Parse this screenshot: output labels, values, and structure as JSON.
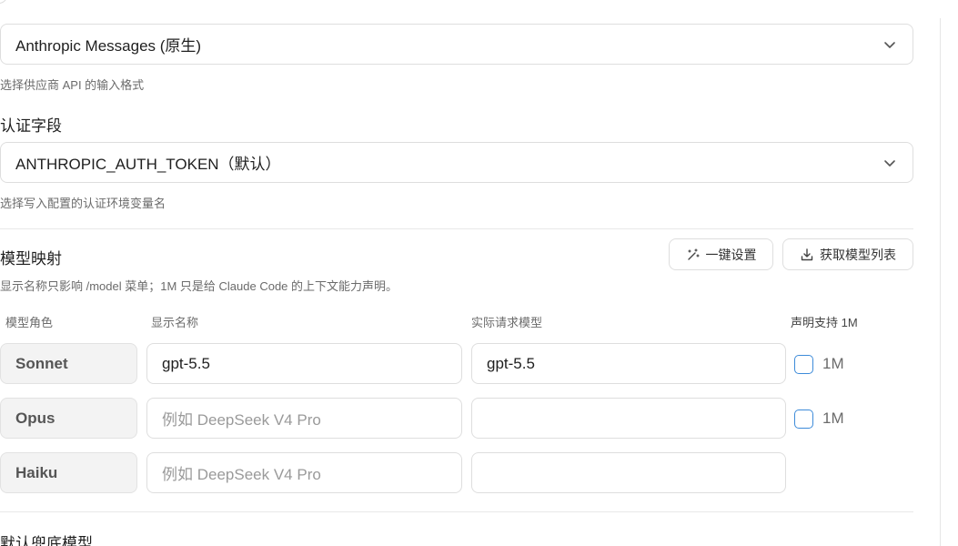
{
  "api_format": {
    "value": "Anthropic Messages (原生)",
    "hint": "选择供应商 API 的输入格式"
  },
  "auth_field": {
    "label": "认证字段",
    "value": "ANTHROPIC_AUTH_TOKEN（默认）",
    "hint": "选择写入配置的认证环境变量名"
  },
  "model_mapping": {
    "title": "模型映射",
    "description": "显示名称只影响 /model 菜单；1M 只是给 Claude Code 的上下文能力声明。",
    "quick_setup_label": "一键设置",
    "fetch_models_label": "获取模型列表",
    "columns": {
      "role": "模型角色",
      "display_name": "显示名称",
      "actual_model": "实际请求模型",
      "support_1m": "声明支持 1M"
    },
    "rows": [
      {
        "role": "Sonnet",
        "display_name": "gpt-5.5",
        "display_placeholder": "",
        "actual_model": "gpt-5.5",
        "has_1m": true,
        "one_m_label": "1M"
      },
      {
        "role": "Opus",
        "display_name": "",
        "display_placeholder": "例如 DeepSeek V4 Pro",
        "actual_model": "",
        "has_1m": true,
        "one_m_label": "1M"
      },
      {
        "role": "Haiku",
        "display_name": "",
        "display_placeholder": "例如 DeepSeek V4 Pro",
        "actual_model": "",
        "has_1m": false,
        "one_m_label": ""
      }
    ]
  },
  "default_fallback": {
    "label": "默认兜底模型"
  },
  "colors": {
    "checkbox_border": "#3d8bd9",
    "border": "#dedede",
    "muted_text": "#6b6b6b"
  }
}
